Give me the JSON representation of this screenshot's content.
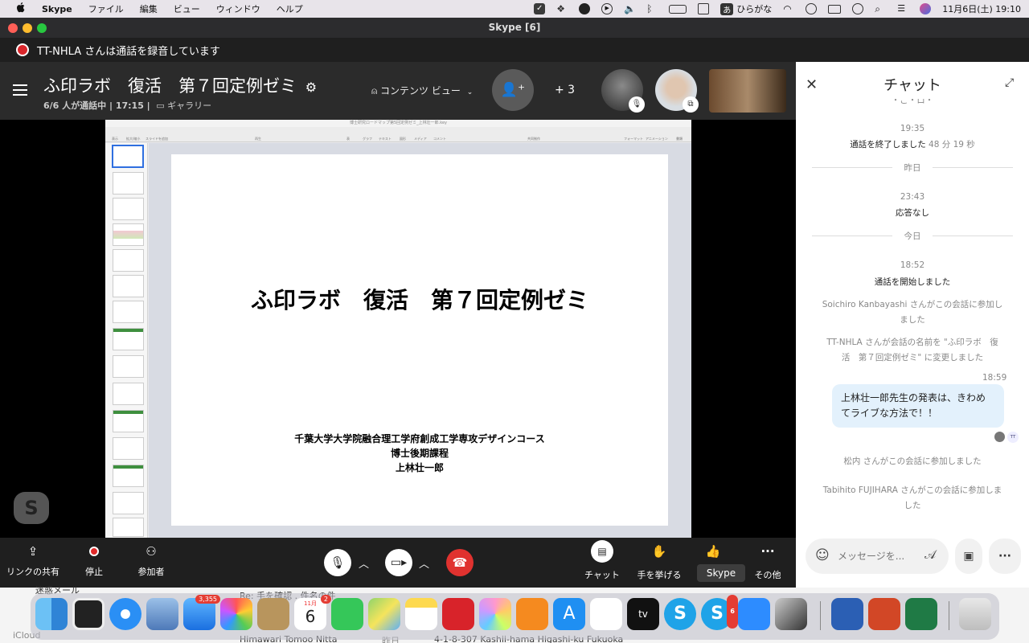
{
  "menubar": {
    "apple": "",
    "app": "Skype",
    "items": [
      "ファイル",
      "編集",
      "ビュー",
      "ウィンドウ",
      "ヘルプ"
    ],
    "ime": "あ",
    "ime_label": "ひらがな",
    "datetime": "11月6日(土)  19:10"
  },
  "window": {
    "title": "Skype [6]"
  },
  "recording": {
    "text": "TT-NHLA さんは通話を録音しています"
  },
  "call": {
    "title": "ふ印ラボ　復活　第７回定例ゼミ",
    "status": "6/6 人が通話中 | 17:15 |",
    "gallery": "ギャラリー",
    "content_view": "コンテンツ ビュー",
    "more": "+ 3"
  },
  "slide": {
    "title": "ふ印ラボ　復活　第７回定例ゼミ",
    "line1": "千葉大学大学院融合理工学府創成工学専攻デザインコース",
    "line2": "博士後期課程",
    "line3": "上林壮一郎"
  },
  "keynote": {
    "toolbar": [
      "表示",
      "拡大/縮小",
      "スライドを追加",
      "再生",
      "表",
      "グラフ",
      "テキスト",
      "図形",
      "メディア",
      "コメント",
      "共同制作",
      "フォーマット",
      "アニメーション",
      "書類"
    ],
    "title_bar": "博士研究ロードマップ第5回定例ゼミ_上林壮一郎.key"
  },
  "controls": {
    "share": "リンクの共有",
    "stop": "停止",
    "participants": "参加者",
    "chat": "チャット",
    "raise": "手を挙げる",
    "more": "その他",
    "tooltip": "Skype"
  },
  "chat": {
    "title": "チャット",
    "cut_top": "・ご・ロ・",
    "t1": "19:35",
    "m1": "通話を終了しました",
    "m1b": "48 分 19 秒",
    "d1": "昨日",
    "t2": "23:43",
    "m2": "応答なし",
    "d2": "今日",
    "t3": "18:52",
    "m3": "通話を開始しました",
    "m4a": "Soichiro Kanbayashi さんがこの会話に参加し",
    "m4b": "ました",
    "m5a": "TT-NHLA さんが会話の名前を \"ふ印ラボ　復",
    "m5b": "活　第７回定例ゼミ\" に変更しました",
    "t4": "18:59",
    "bubble1": "上林壮一郎先生の発表は、きわめ",
    "bubble2": "てライブな方法で！！",
    "tt": "TT",
    "m6": "松内 さんがこの会話に参加しました",
    "m7a": "Tabihito FUJIHARA さんがこの会話に参加しま",
    "m7b": "した",
    "input_placeholder": "メッセージを..."
  },
  "dock": {
    "mail_badge": "3,355",
    "cal_month": "11月",
    "cal_day": "6",
    "cal_badge": "2",
    "skype_badge": "6",
    "tv": "tv"
  },
  "behind": {
    "left": "迷惑メール",
    "left2": "iCloud",
    "row1": "Himawari Tomoo Nitta",
    "row2": "4-1-8-307 Kashii-hama Higashi-ku Fukuoka",
    "row3": "昨日",
    "row4": "Re: 手を確認 . 件名の件"
  },
  "colors": {
    "accent": "#0078d4",
    "record": "#d9262b",
    "bubble": "#e3f1fc"
  }
}
